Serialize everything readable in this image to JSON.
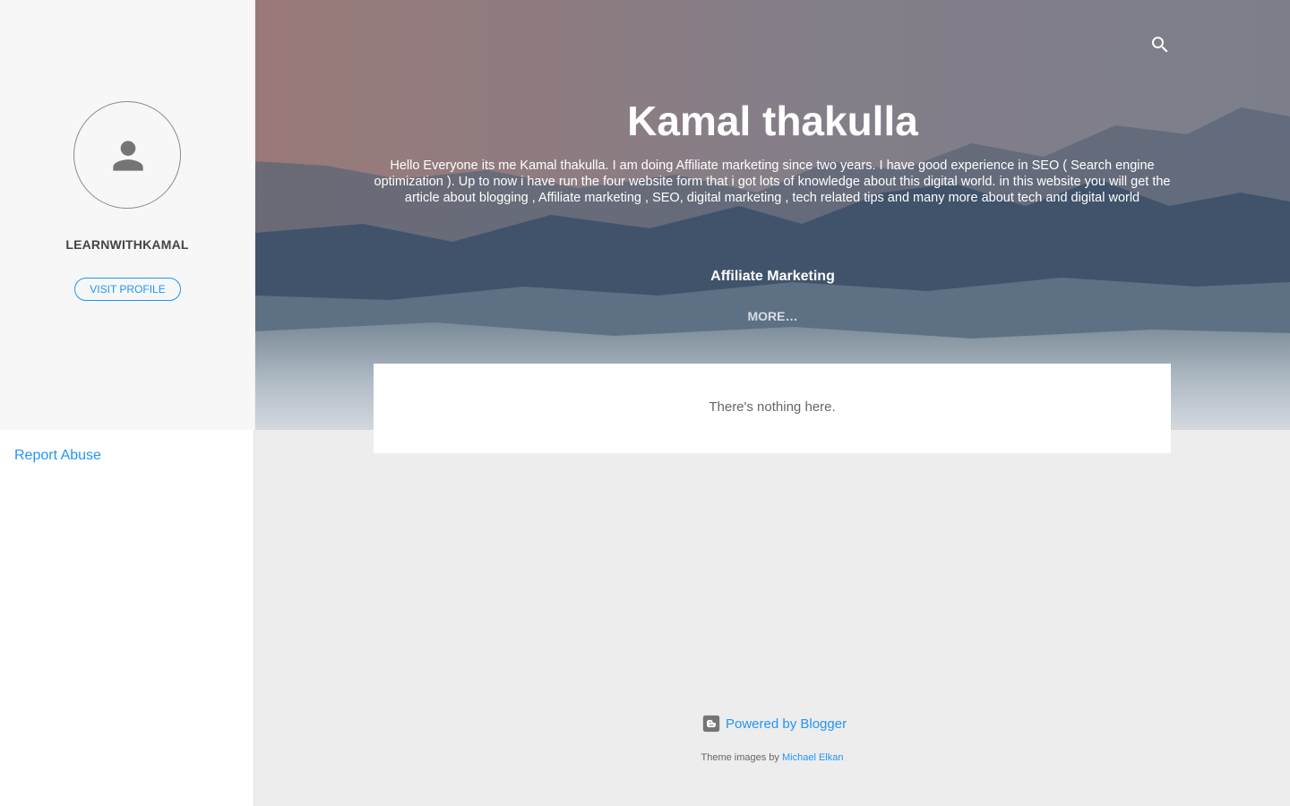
{
  "sidebar": {
    "profile_name": "LEARNWITHKAMAL",
    "visit_profile_label": "VISIT PROFILE",
    "report_abuse_label": "Report Abuse"
  },
  "header": {
    "title": "Kamal thakulla",
    "description": "Hello Everyone its me Kamal thakulla. I am doing Affiliate marketing since two years. I have good experience in SEO ( Search engine optimization ). Up to now i have run the four website form that i got lots of knowledge about this digital world. in this website you will get the article about blogging , Affiliate marketing , SEO, digital marketing , tech related tips and many more about tech and digital world",
    "nav_label": "Affiliate Marketing",
    "more_label": "MORE…"
  },
  "main": {
    "empty_message": "There's nothing here."
  },
  "footer": {
    "powered_label": "Powered by Blogger",
    "theme_prefix": "Theme images by",
    "theme_author": "Michael Elkan"
  },
  "colors": {
    "accent": "#2196f3",
    "sidebar_bg": "#f7f7f7",
    "page_bg": "#ededed"
  },
  "icons": [
    "person-icon",
    "search-icon",
    "blogger-icon"
  ]
}
